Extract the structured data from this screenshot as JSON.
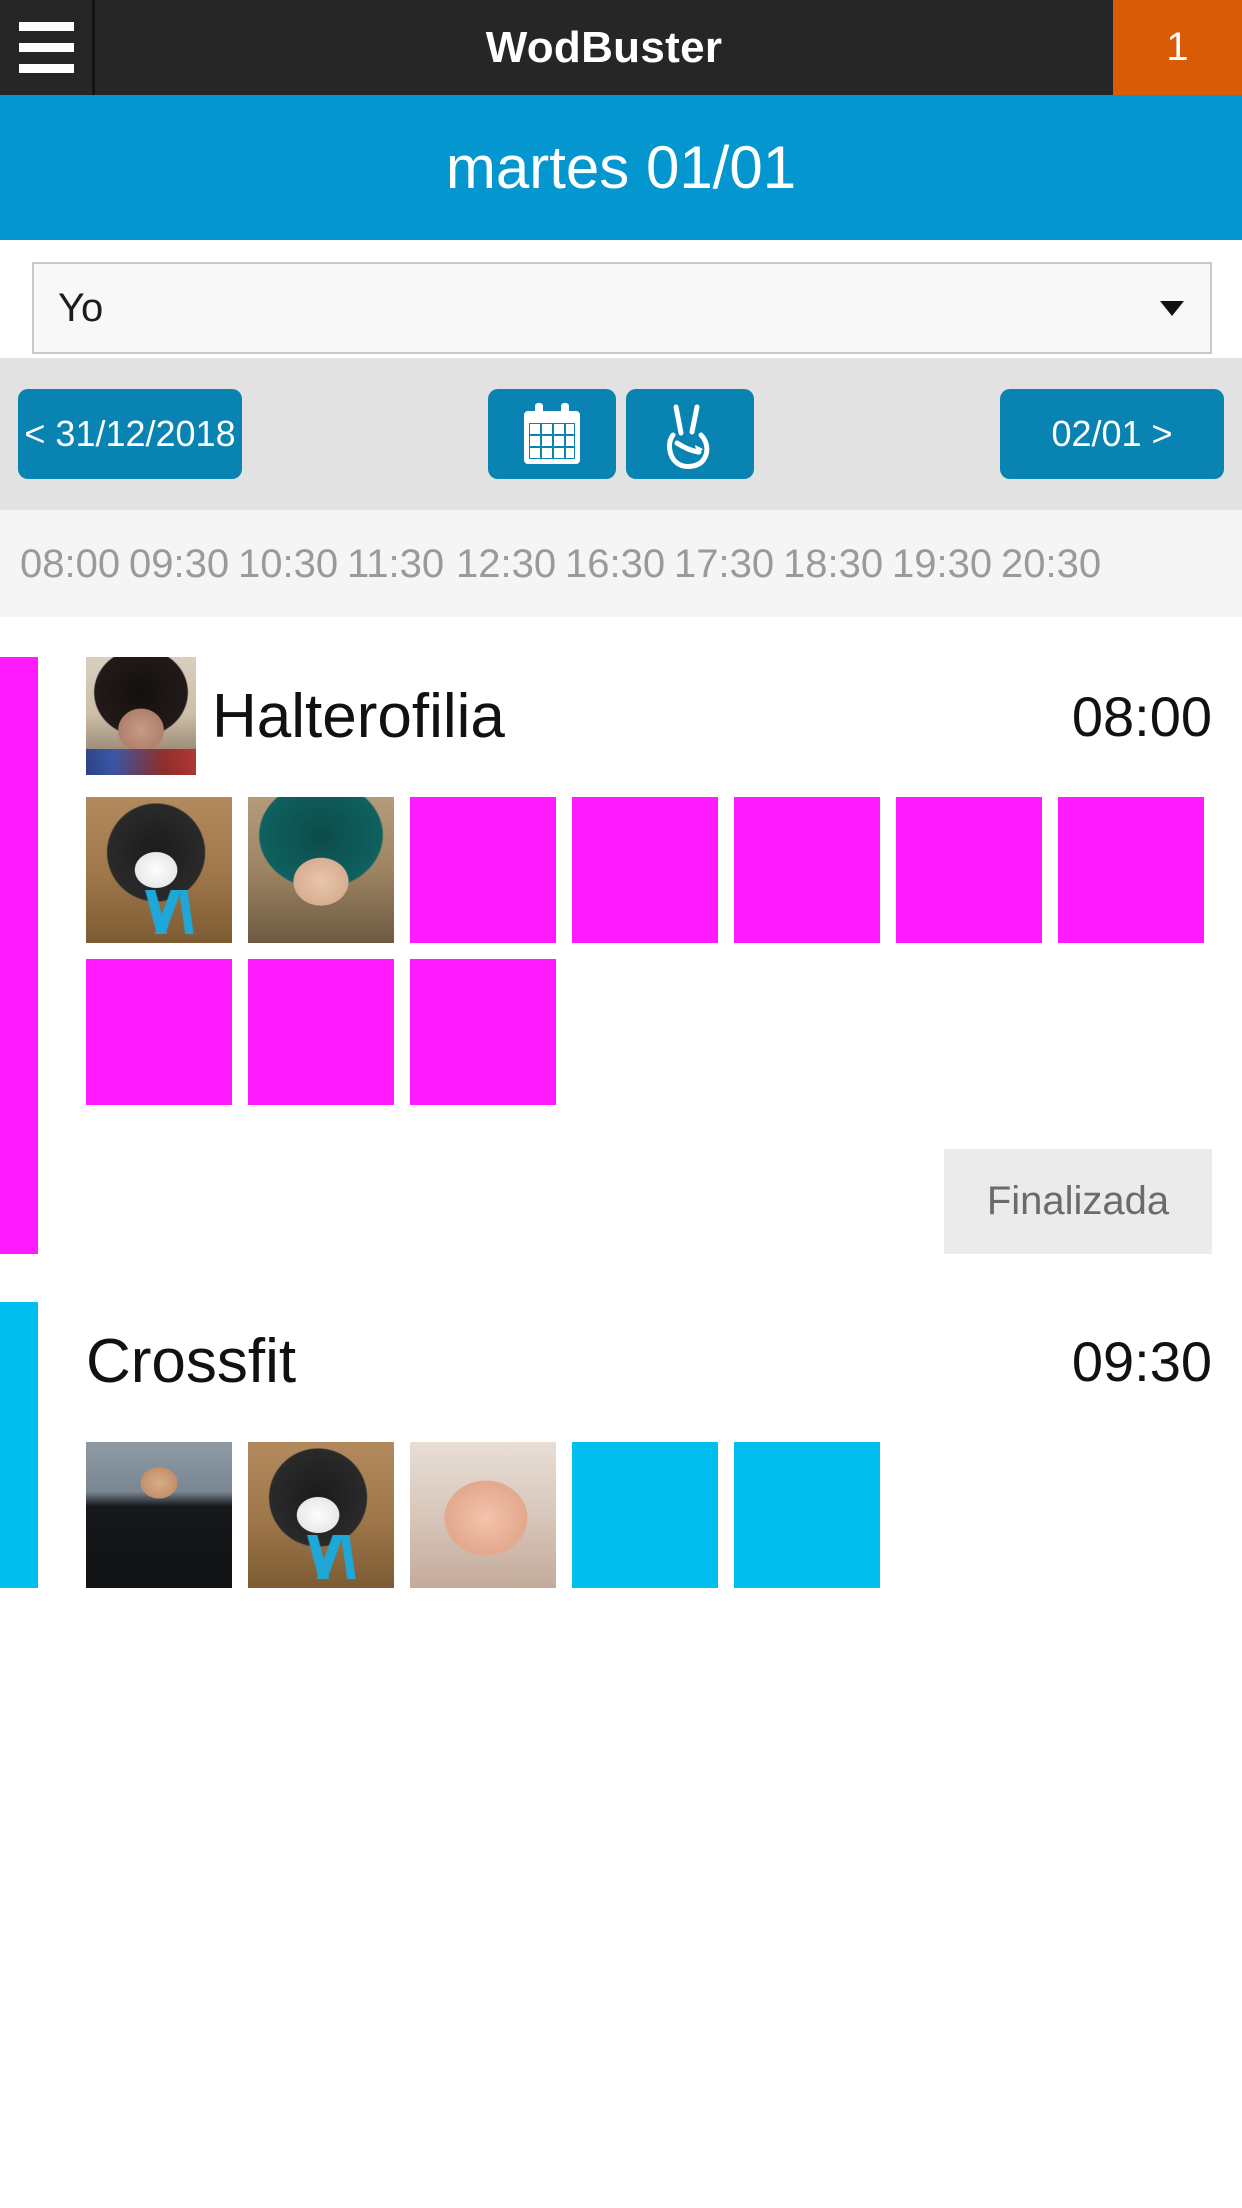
{
  "topbar": {
    "menu_icon": "hamburger-icon",
    "title": "WodBuster",
    "badge_count": "1",
    "badge_color": "#D95B06",
    "background": "#262626"
  },
  "daybar": {
    "label": "martes 01/01",
    "background": "#0496CE"
  },
  "filter": {
    "selected": "Yo",
    "caret_icon": "chevron-down-icon"
  },
  "nav": {
    "prev_label": "< 31/12/2018",
    "next_label": "02/01 >",
    "calendar_icon": "calendar-icon",
    "hand_icon": "peace-hand-icon",
    "button_color": "#0883B2",
    "background": "#E2E2E2"
  },
  "time_slots": [
    "08:00",
    "09:30",
    "10:30",
    "11:30",
    "12:30",
    "16:30",
    "17:30",
    "18:30",
    "19:30",
    "20:30"
  ],
  "classes": [
    {
      "name": "Halterofilia",
      "time": "08:00",
      "accent_color": "#FF1AFF",
      "coach_avatar": "coach-portrait-avatar",
      "attendees": [
        {
          "art": "art-dog",
          "name": "attendee-avatar-dog"
        },
        {
          "art": "art-teal",
          "name": "attendee-avatar-teal-hair"
        },
        {
          "art": "",
          "name": "attendee-avatar-placeholder"
        },
        {
          "art": "",
          "name": "attendee-avatar-placeholder"
        },
        {
          "art": "",
          "name": "attendee-avatar-placeholder"
        },
        {
          "art": "",
          "name": "attendee-avatar-placeholder"
        },
        {
          "art": "",
          "name": "attendee-avatar-placeholder"
        },
        {
          "art": "",
          "name": "attendee-avatar-placeholder"
        },
        {
          "art": "",
          "name": "attendee-avatar-placeholder"
        },
        {
          "art": "",
          "name": "attendee-avatar-placeholder"
        }
      ],
      "status": "Finalizada"
    },
    {
      "name": "Crossfit",
      "time": "09:30",
      "accent_color": "#00BFEF",
      "coach_avatar": "",
      "attendees": [
        {
          "art": "art-man",
          "name": "attendee-avatar-man"
        },
        {
          "art": "art-dog",
          "name": "attendee-avatar-dog"
        },
        {
          "art": "art-baby",
          "name": "attendee-avatar-baby"
        },
        {
          "art": "",
          "name": "attendee-avatar-placeholder"
        },
        {
          "art": "",
          "name": "attendee-avatar-placeholder"
        }
      ],
      "status": ""
    }
  ]
}
